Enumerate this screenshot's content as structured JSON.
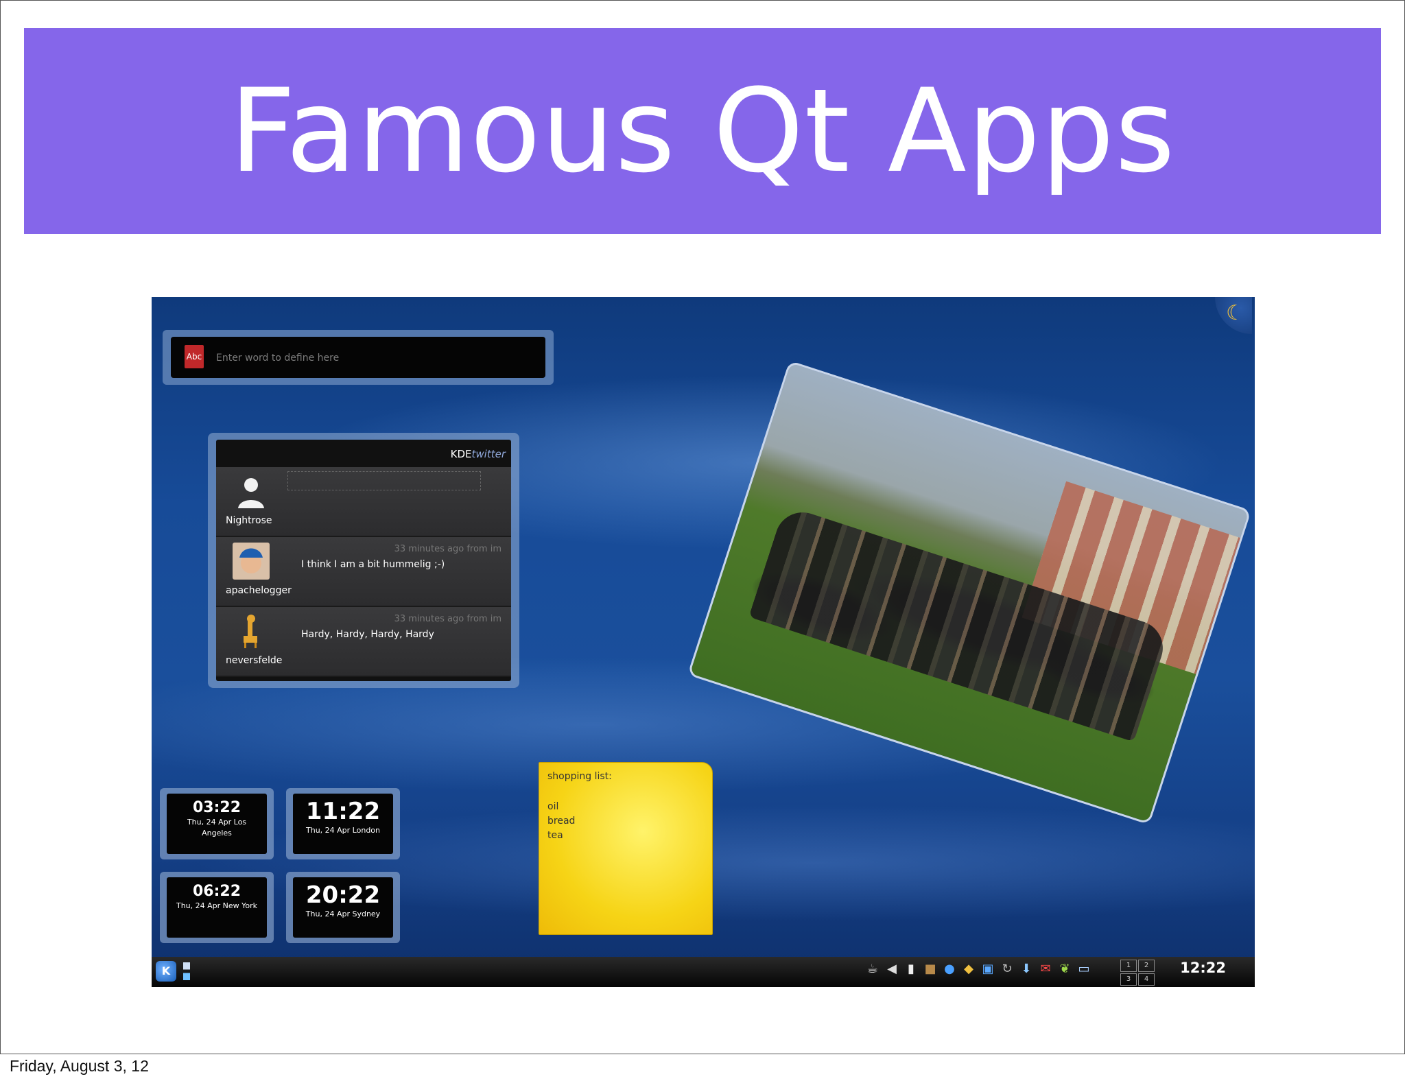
{
  "slide": {
    "title": "Famous Qt Apps",
    "footer_date": "Friday, August 3, 12"
  },
  "screenshot": {
    "dictionary": {
      "placeholder": "Enter word to define here",
      "icon": "dictionary-book-icon"
    },
    "twitter": {
      "brand_main": "KDE",
      "brand_accent": "twitter",
      "entries": [
        {
          "user": "Nightrose",
          "meta": "",
          "text": ""
        },
        {
          "user": "apachelogger",
          "meta": "33 minutes ago from im",
          "text": "I think I am a bit hummelig ;-)"
        },
        {
          "user": "neversfelde",
          "meta": "33 minutes ago from im",
          "text": "Hardy, Hardy, Hardy, Hardy"
        }
      ]
    },
    "clocks": [
      {
        "time": "03:22",
        "date": "Thu, 24 Apr Los Angeles"
      },
      {
        "time": "11:22",
        "date": "Thu, 24 Apr London"
      },
      {
        "time": "06:22",
        "date": "Thu, 24 Apr New York"
      },
      {
        "time": "20:22",
        "date": "Thu, 24 Apr Sydney"
      }
    ],
    "note": {
      "title": "shopping list:",
      "items": [
        "oil",
        "bread",
        "tea"
      ]
    },
    "taskbar": {
      "kmenu_label": "K",
      "pager": [
        "1",
        "2",
        "3",
        "4"
      ],
      "clock": "12:22"
    }
  },
  "colors": {
    "banner": "#8566ea",
    "note": "#f6d416"
  }
}
